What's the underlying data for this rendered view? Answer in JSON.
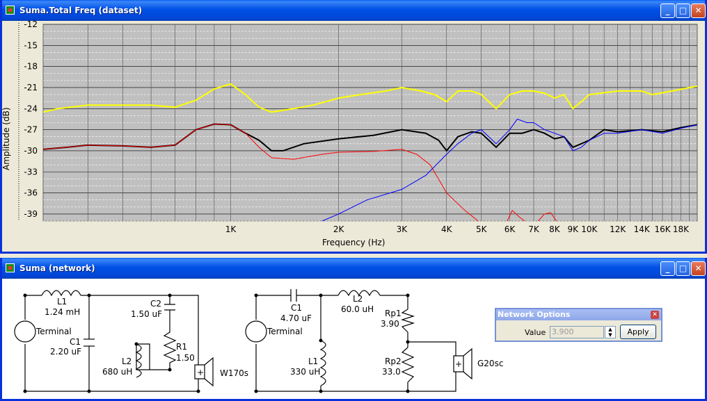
{
  "freq_window": {
    "title": "Suma.Total Freq (dataset)",
    "y_axis_label": "Amplitude (dB)",
    "x_axis_label": "Frequency (Hz)"
  },
  "chart_data": {
    "type": "line",
    "xscale": "log",
    "xlabel": "Frequency (Hz)",
    "ylabel": "Amplitude (dB)",
    "ylim": [
      -40,
      -12
    ],
    "y_ticks": [
      "-12",
      "-15",
      "-18",
      "-21",
      "-24",
      "-27",
      "-30",
      "-33",
      "-36",
      "-39"
    ],
    "x_ticks": [
      {
        "v": 1000,
        "label": "1K"
      },
      {
        "v": 2000,
        "label": "2K"
      },
      {
        "v": 3000,
        "label": "3K"
      },
      {
        "v": 4000,
        "label": "4K"
      },
      {
        "v": 5000,
        "label": "5K"
      },
      {
        "v": 6000,
        "label": "6K"
      },
      {
        "v": 7000,
        "label": "7K"
      },
      {
        "v": 8000,
        "label": "8K"
      },
      {
        "v": 9000,
        "label": "9K"
      },
      {
        "v": 10000,
        "label": "10K"
      },
      {
        "v": 12000,
        "label": "12K"
      },
      {
        "v": 14000,
        "label": "14K"
      },
      {
        "v": 16000,
        "label": "16K"
      },
      {
        "v": 18000,
        "label": "18K"
      }
    ],
    "grid": true,
    "series": [
      {
        "color": "#ffff00",
        "points": [
          [
            300,
            -24.5
          ],
          [
            330,
            -24
          ],
          [
            400,
            -23.5
          ],
          [
            500,
            -23.5
          ],
          [
            600,
            -23.5
          ],
          [
            700,
            -23.8
          ],
          [
            800,
            -22.8
          ],
          [
            900,
            -21.2
          ],
          [
            1000,
            -20.5
          ],
          [
            1100,
            -22
          ],
          [
            1200,
            -23.8
          ],
          [
            1300,
            -24.5
          ],
          [
            1500,
            -24
          ],
          [
            1700,
            -23.5
          ],
          [
            2000,
            -22.5
          ],
          [
            2300,
            -22
          ],
          [
            2700,
            -21.5
          ],
          [
            3000,
            -21
          ],
          [
            3400,
            -21.5
          ],
          [
            3700,
            -22
          ],
          [
            4000,
            -23
          ],
          [
            4300,
            -21.5
          ],
          [
            4700,
            -21.5
          ],
          [
            5000,
            -22
          ],
          [
            5500,
            -24
          ],
          [
            6000,
            -22
          ],
          [
            6500,
            -21.5
          ],
          [
            7000,
            -21.5
          ],
          [
            7500,
            -21.8
          ],
          [
            8000,
            -22.5
          ],
          [
            8500,
            -22
          ],
          [
            9000,
            -24
          ],
          [
            9500,
            -23
          ],
          [
            10000,
            -22
          ],
          [
            12000,
            -21.5
          ],
          [
            14000,
            -21.5
          ],
          [
            15000,
            -22
          ],
          [
            17000,
            -21.5
          ],
          [
            20000,
            -20.8
          ]
        ]
      },
      {
        "color": "#000000",
        "points": [
          [
            300,
            -29.8
          ],
          [
            350,
            -29.5
          ],
          [
            400,
            -29.2
          ],
          [
            500,
            -29.3
          ],
          [
            600,
            -29.5
          ],
          [
            700,
            -29.2
          ],
          [
            800,
            -27
          ],
          [
            900,
            -26.2
          ],
          [
            1000,
            -26.3
          ],
          [
            1100,
            -27.5
          ],
          [
            1200,
            -28.5
          ],
          [
            1300,
            -30
          ],
          [
            1400,
            -30
          ],
          [
            1600,
            -29
          ],
          [
            2000,
            -28.3
          ],
          [
            2500,
            -27.8
          ],
          [
            3000,
            -27
          ],
          [
            3500,
            -27.5
          ],
          [
            3800,
            -28.5
          ],
          [
            4000,
            -30
          ],
          [
            4300,
            -28
          ],
          [
            4700,
            -27.3
          ],
          [
            5000,
            -27.5
          ],
          [
            5500,
            -29.5
          ],
          [
            6000,
            -27.5
          ],
          [
            6500,
            -27.5
          ],
          [
            7000,
            -27
          ],
          [
            7500,
            -27.5
          ],
          [
            8000,
            -28.3
          ],
          [
            8500,
            -28
          ],
          [
            9000,
            -29.5
          ],
          [
            9500,
            -29
          ],
          [
            10000,
            -28.5
          ],
          [
            11000,
            -27
          ],
          [
            12000,
            -27.3
          ],
          [
            14000,
            -27
          ],
          [
            16000,
            -27.3
          ],
          [
            18000,
            -26.7
          ],
          [
            20000,
            -26.3
          ]
        ]
      },
      {
        "color": "#ff0000",
        "points": [
          [
            300,
            -29.8
          ],
          [
            350,
            -29.5
          ],
          [
            400,
            -29.2
          ],
          [
            500,
            -29.3
          ],
          [
            600,
            -29.5
          ],
          [
            700,
            -29.2
          ],
          [
            800,
            -27
          ],
          [
            900,
            -26.2
          ],
          [
            1000,
            -26.3
          ],
          [
            1100,
            -27.5
          ],
          [
            1200,
            -29.5
          ],
          [
            1300,
            -31
          ],
          [
            1500,
            -31.2
          ],
          [
            1800,
            -30.5
          ],
          [
            2000,
            -30.2
          ],
          [
            2500,
            -30.1
          ],
          [
            3000,
            -29.8
          ],
          [
            3300,
            -30.5
          ],
          [
            3600,
            -32
          ],
          [
            4000,
            -36
          ],
          [
            4500,
            -38.5
          ],
          [
            4900,
            -40
          ]
        ]
      },
      {
        "color": "#0000ff",
        "points": [
          [
            1800,
            -40
          ],
          [
            2000,
            -39
          ],
          [
            2400,
            -37
          ],
          [
            3000,
            -35.5
          ],
          [
            3500,
            -33.5
          ],
          [
            4000,
            -30.5
          ],
          [
            4300,
            -29
          ],
          [
            4700,
            -27.5
          ],
          [
            5000,
            -27
          ],
          [
            5500,
            -29
          ],
          [
            6000,
            -27
          ],
          [
            6300,
            -25.5
          ],
          [
            6700,
            -26
          ],
          [
            7000,
            -26
          ],
          [
            7500,
            -27
          ],
          [
            8000,
            -27.5
          ],
          [
            8500,
            -28
          ],
          [
            9000,
            -30
          ],
          [
            9500,
            -29.5
          ],
          [
            10000,
            -28.5
          ],
          [
            11000,
            -27.5
          ],
          [
            12000,
            -27.5
          ],
          [
            14000,
            -27
          ],
          [
            16000,
            -27.5
          ],
          [
            18000,
            -26.8
          ],
          [
            20000,
            -26.3
          ]
        ]
      },
      {
        "color": "#ff0000",
        "points": [
          [
            5900,
            -40
          ],
          [
            6100,
            -38.5
          ],
          [
            6400,
            -39.5
          ],
          [
            6600,
            -40
          ]
        ]
      },
      {
        "color": "#ff0000",
        "points": [
          [
            7200,
            -40
          ],
          [
            7500,
            -39
          ],
          [
            7800,
            -38.8
          ],
          [
            8100,
            -40
          ]
        ]
      }
    ]
  },
  "net_window": {
    "title": "Suma (network)",
    "circuit1": {
      "terminal": "Terminal",
      "L1": {
        "name": "L1",
        "value": "1.24 mH"
      },
      "C1": {
        "name": "C1",
        "value": "2.20 uF"
      },
      "C2": {
        "name": "C2",
        "value": "1.50 uF"
      },
      "L2": {
        "name": "L2",
        "value": "680 uH"
      },
      "R1": {
        "name": "R1",
        "value": "1.50"
      },
      "speaker": "W170s"
    },
    "circuit2": {
      "terminal": "Terminal",
      "C1": {
        "name": "C1",
        "value": "4.70 uF"
      },
      "L2": {
        "name": "L2",
        "value": "60.0 uH"
      },
      "L1": {
        "name": "L1",
        "value": "330 uH"
      },
      "Rp1": {
        "name": "Rp1",
        "value": "3.90"
      },
      "Rp2": {
        "name": "Rp2",
        "value": "33.0"
      },
      "speaker": "G20sc"
    }
  },
  "net_options": {
    "title": "Network Options",
    "value_label": "Value",
    "value": "3.900",
    "apply_label": "Apply"
  }
}
